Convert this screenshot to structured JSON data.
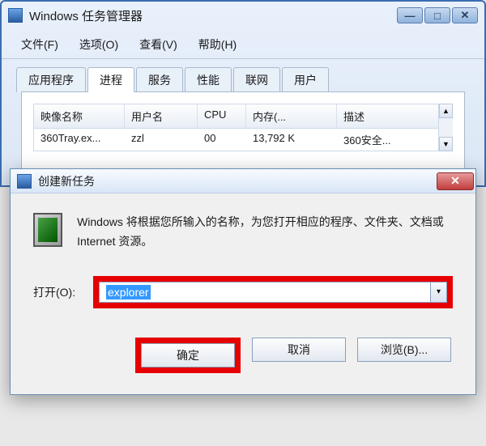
{
  "taskmgr": {
    "title": "Windows 任务管理器",
    "menus": {
      "file": "文件(F)",
      "options": "选项(O)",
      "view": "查看(V)",
      "help": "帮助(H)"
    },
    "tabs": {
      "apps": "应用程序",
      "processes": "进程",
      "services": "服务",
      "performance": "性能",
      "network": "联网",
      "users": "用户"
    },
    "columns": {
      "name": "映像名称",
      "user": "用户名",
      "cpu": "CPU",
      "mem": "内存(...",
      "desc": "描述"
    },
    "rows": [
      {
        "name": "360Tray.ex...",
        "user": "zzl",
        "cpu": "00",
        "mem": "13,792 K",
        "desc": "360安全..."
      }
    ]
  },
  "dialog": {
    "title": "创建新任务",
    "message": "Windows 将根据您所输入的名称，为您打开相应的程序、文件夹、文档或 Internet 资源。",
    "open_label": "打开(O):",
    "open_value": "explorer",
    "buttons": {
      "ok": "确定",
      "cancel": "取消",
      "browse": "浏览(B)..."
    }
  }
}
